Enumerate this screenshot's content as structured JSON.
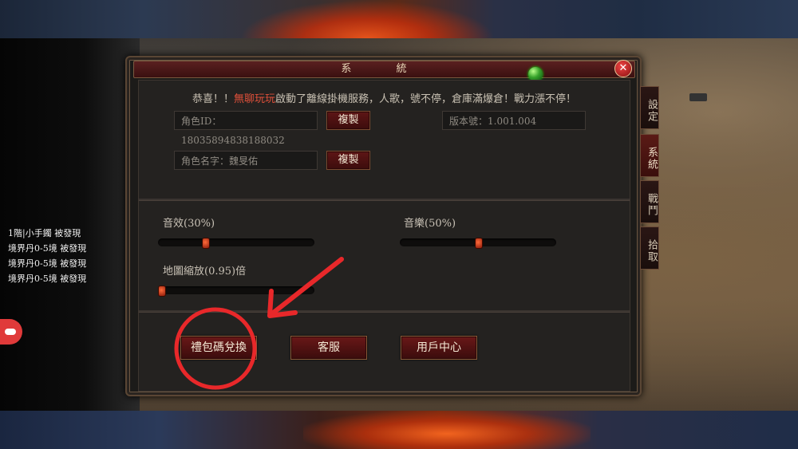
{
  "window": {
    "title": "系  統",
    "close_symbol": "✕"
  },
  "announcement": {
    "prefix": "恭喜！！",
    "highlight": "無聊玩玩",
    "suffix": "啟動了離線掛機服務，人歌，號不停，倉庫滿爆倉！戰力漲不停！"
  },
  "account": {
    "role_id_label": "角色ID：",
    "role_id": "18035894838188032",
    "copy_label_1": "複製",
    "version_label": "版本號：",
    "version": "1.001.004",
    "role_name_label": "角色名字：",
    "role_name": "魏旻佑",
    "copy_label_2": "複製"
  },
  "settings": {
    "sfx_label": "音效(30%)",
    "sfx_value": 0.3,
    "music_label": "音樂(50%)",
    "music_value": 0.5,
    "zoom_label": "地圖縮放(0.95)倍",
    "zoom_value": 0.0
  },
  "buttons": {
    "gift_code": "禮包碼兌換",
    "support": "客服",
    "user_center": "用戶中心"
  },
  "side_tabs": [
    "設定",
    "系統",
    "戰鬥",
    "拾取"
  ],
  "log": [
    "1階|小手鐲 被發現",
    "境界丹0-5境 被發現",
    "境界丹0-5境 被發現",
    "境界丹0-5境 被發現"
  ],
  "colors": {
    "annotation_red": "#e8282a",
    "highlight_text": "#e0503a"
  },
  "icons": [
    "gem-icon",
    "close-icon",
    "gamepad-icon"
  ]
}
